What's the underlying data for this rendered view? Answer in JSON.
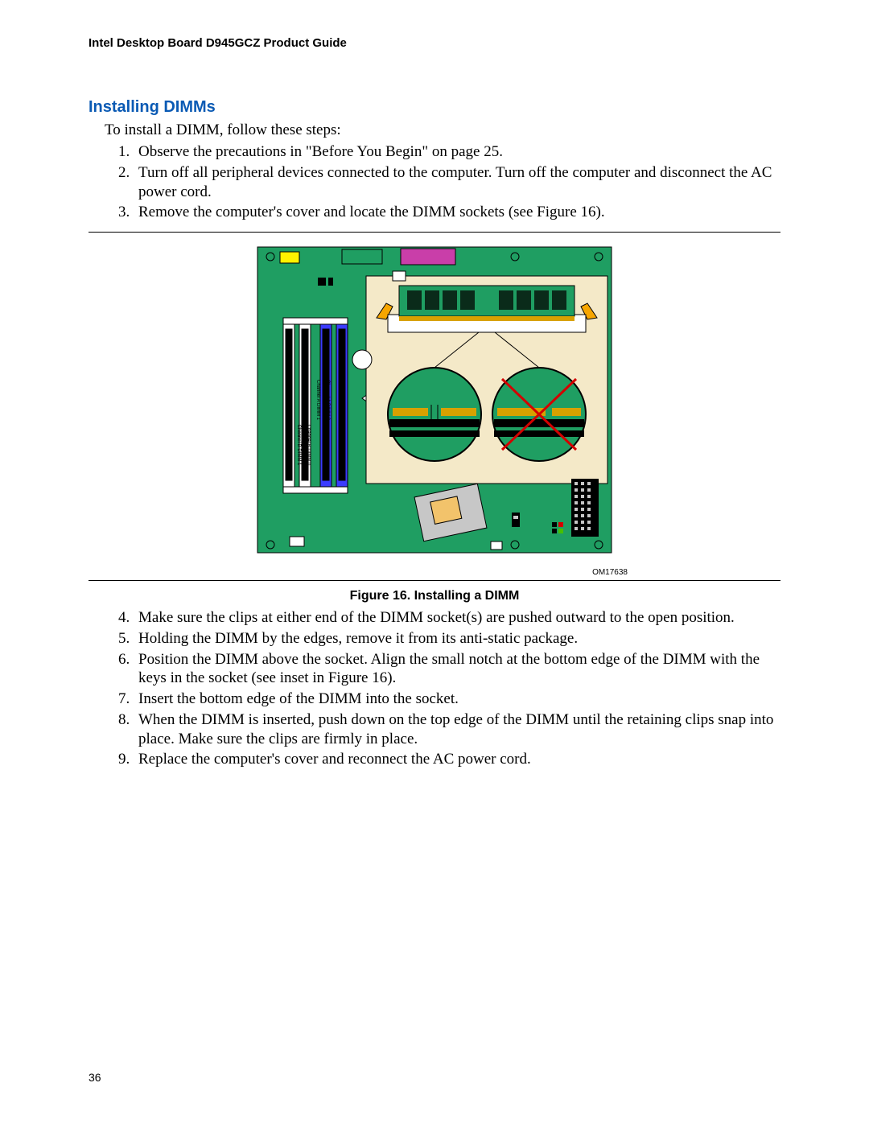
{
  "header": "Intel Desktop Board D945GCZ Product Guide",
  "section_heading": "Installing DIMMs",
  "intro": "To install a DIMM, follow these steps:",
  "steps_top": [
    "Observe the precautions in \"Before You Begin\" on page 25.",
    "Turn off all peripheral devices connected to the computer.  Turn off the computer and disconnect the AC power cord.",
    "Remove the computer's cover and locate the DIMM sockets (see Figure 16)."
  ],
  "figure": {
    "caption": "Figure 16.  Installing a DIMM",
    "ref": "OM17638",
    "dimm_labels": {
      "a0": "Channel A DIMM 0",
      "a1": "Channel A DIMM 1",
      "b0": "Channel B DIMM 0",
      "b1": "Channel B DIMM 1"
    }
  },
  "steps_bottom": [
    "Make sure the clips at either end of the DIMM socket(s) are pushed outward to the open position.",
    "Holding the DIMM by the edges, remove it from its anti-static package.",
    "Position the DIMM above the socket.  Align the small notch at the bottom edge of the DIMM with the keys in the socket (see inset in Figure 16).",
    "Insert the bottom edge of the DIMM into the socket.",
    "When the DIMM is inserted, push down on the top edge of the DIMM until the retaining clips snap into place.  Make sure the clips are firmly in place.",
    "Replace the computer's cover and reconnect the AC power cord."
  ],
  "page_number": "36"
}
